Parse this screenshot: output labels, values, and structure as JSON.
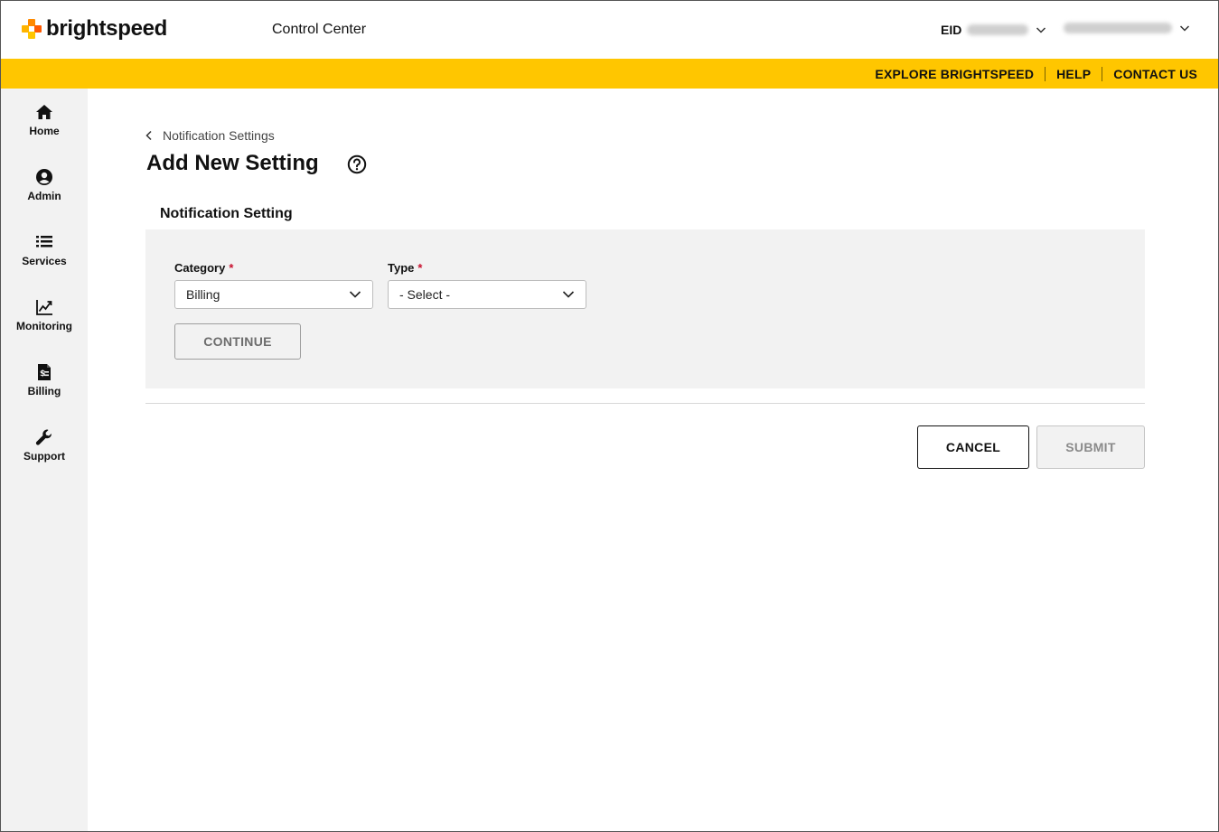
{
  "header": {
    "logo_text": "brightspeed",
    "app_title": "Control Center",
    "eid_label": "EID",
    "eid_value": "12967505",
    "user_value": "12967505euser1"
  },
  "utility_nav": {
    "explore": "EXPLORE BRIGHTSPEED",
    "help": "HELP",
    "contact": "CONTACT US"
  },
  "sidebar": {
    "items": [
      {
        "label": "Home",
        "icon": "home-icon"
      },
      {
        "label": "Admin",
        "icon": "user-circle-icon"
      },
      {
        "label": "Services",
        "icon": "list-icon"
      },
      {
        "label": "Monitoring",
        "icon": "chart-line-icon"
      },
      {
        "label": "Billing",
        "icon": "invoice-dollar-icon"
      },
      {
        "label": "Support",
        "icon": "wrench-icon"
      }
    ]
  },
  "breadcrumb": {
    "back_label": "Notification Settings"
  },
  "page": {
    "title": "Add New Setting"
  },
  "form": {
    "section_title": "Notification Setting",
    "category": {
      "label": "Category",
      "required_mark": "*",
      "value": "Billing"
    },
    "type": {
      "label": "Type",
      "required_mark": "*",
      "value": "- Select -"
    },
    "continue_label": "CONTINUE"
  },
  "actions": {
    "cancel_label": "CANCEL",
    "submit_label": "SUBMIT"
  },
  "colors": {
    "brand_yellow": "#ffc600",
    "sidebar_bg": "#f2f2f2",
    "panel_bg": "#f2f2f2",
    "required": "#c8102e"
  }
}
